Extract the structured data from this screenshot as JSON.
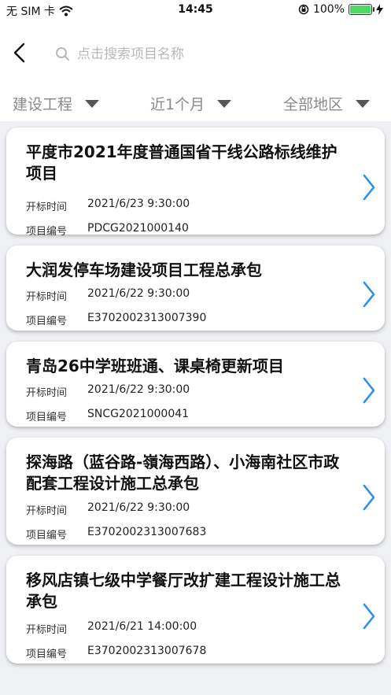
{
  "status_bar": {
    "carrier": "无 SIM 卡",
    "time": "14:45",
    "battery": "100%",
    "battery_level": 1.0
  },
  "search": {
    "placeholder": "点击搜索项目名称"
  },
  "filters": [
    {
      "label": "建设工程"
    },
    {
      "label": "近1个月"
    },
    {
      "label": "全部地区"
    }
  ],
  "projects": [
    {
      "title": "平度市2021年度普通国省干线公路标线维护项目",
      "open_time_label": "开标时间",
      "open_time": "2021/6/23 9:30:00",
      "code_label": "项目编号",
      "code": "PDCG2021000140"
    },
    {
      "title": "大润发停车场建设项目工程总承包",
      "open_time_label": "开标时间",
      "open_time": "2021/6/22 9:30:00",
      "code_label": "项目编号",
      "code": "E3702002313007390"
    },
    {
      "title": "青岛26中学班班通、课桌椅更新项目",
      "open_time_label": "开标时间",
      "open_time": "2021/6/22 9:30:00",
      "code_label": "项目编号",
      "code": "SNCG2021000041"
    },
    {
      "title": "探海路（蓝谷路-嶺海西路）、小海南社区市政配套工程设计施工总承包",
      "open_time_label": "开标时间",
      "open_time": "2021/6/22 9:30:00",
      "code_label": "项目编号",
      "code": "E3702002313007683"
    },
    {
      "title": "移风店镇七级中学餐厅改扩建工程设计施工总承包",
      "open_time_label": "开标时间",
      "open_time": "2021/6/21 14:00:00",
      "code_label": "项目编号",
      "code": "E3702002313007678"
    }
  ]
}
